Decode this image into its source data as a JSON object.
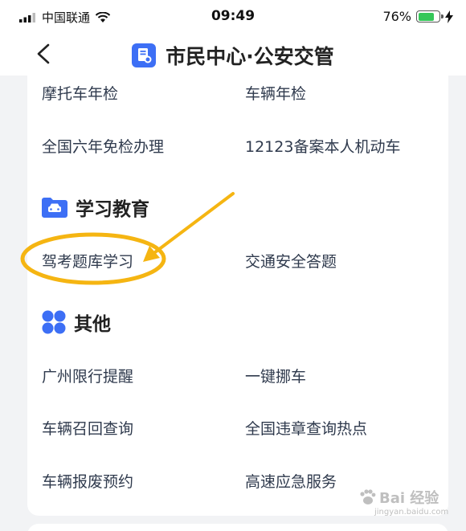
{
  "status_bar": {
    "carrier": "中国联通",
    "time": "09:49",
    "battery": "76%",
    "battery_level": 0.76
  },
  "nav": {
    "title": "市民中心·公安交管"
  },
  "sections": {
    "top_items": {
      "row1": [
        "摩托车年检",
        "车辆年检"
      ],
      "row2": [
        "全国六年免检办理",
        "12123备案本人机动车"
      ]
    },
    "study": {
      "title": "学习教育",
      "items": [
        "驾考题库学习",
        "交通安全答题"
      ]
    },
    "other": {
      "title": "其他",
      "row1": [
        "广州限行提醒",
        "一键挪车"
      ],
      "row2": [
        "车辆召回查询",
        "全国违章查询热点"
      ],
      "row3": [
        "车辆报废预约",
        "高速应急服务"
      ]
    }
  },
  "colors": {
    "accent_blue": "#3d6ff5",
    "annotation_yellow": "#f5b512",
    "item_text": "#2f3a4d"
  },
  "watermark": {
    "text": "Bai 经验",
    "sub": "jingyan.baidu.com"
  }
}
